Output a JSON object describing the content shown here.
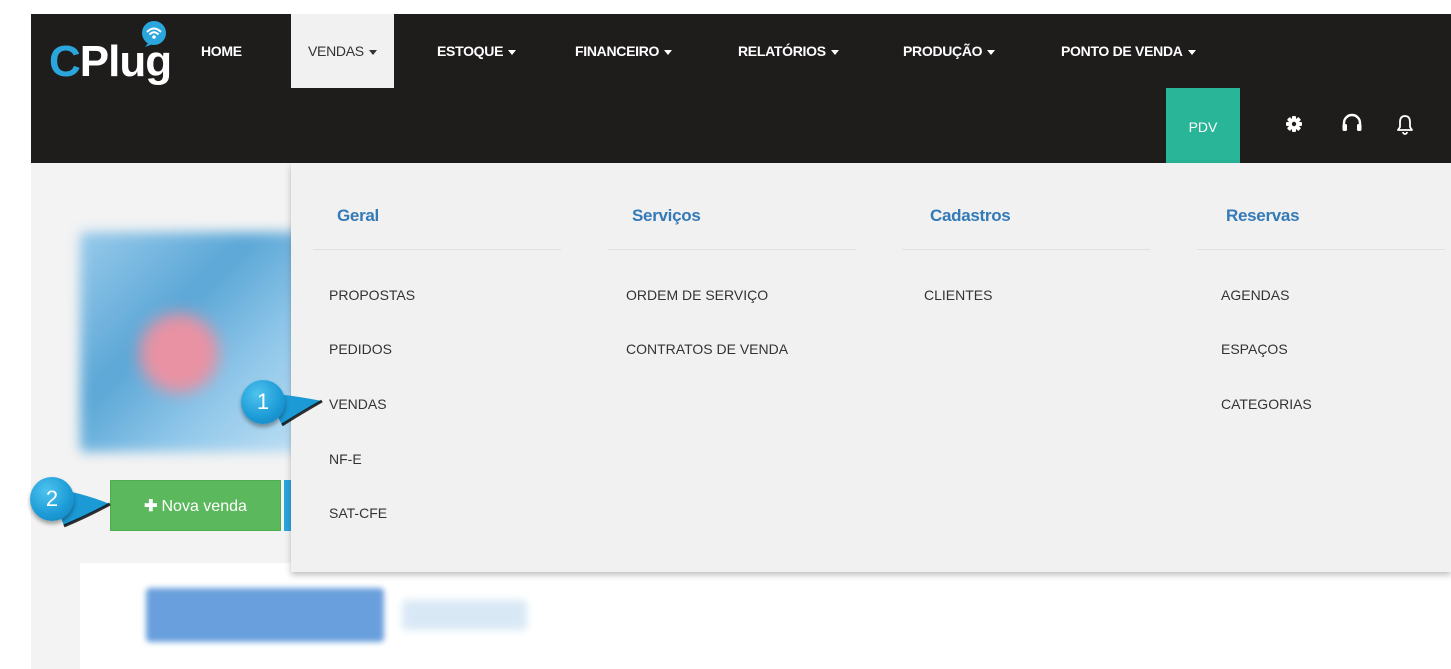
{
  "brand": {
    "logo_text_c": "C",
    "logo_text_rest": "Plug"
  },
  "nav": {
    "items": [
      {
        "label": "HOME"
      },
      {
        "label": "VENDAS"
      },
      {
        "label": "ESTOQUE"
      },
      {
        "label": "FINANCEIRO"
      },
      {
        "label": "RELATÓRIOS"
      },
      {
        "label": "PRODUÇÃO"
      },
      {
        "label": "PONTO DE VENDA"
      }
    ],
    "pdv_label": "PDV",
    "icons": [
      "gear-icon",
      "headset-icon",
      "bell-icon"
    ]
  },
  "dropdown": {
    "columns": [
      {
        "heading": "Geral",
        "links": [
          "PROPOSTAS",
          "PEDIDOS",
          "VENDAS",
          "NF-E",
          "SAT-CFE"
        ]
      },
      {
        "heading": "Serviços",
        "links": [
          "ORDEM DE SERVIÇO",
          "CONTRATOS DE VENDA"
        ]
      },
      {
        "heading": "Cadastros",
        "links": [
          "CLIENTES"
        ]
      },
      {
        "heading": "Reservas",
        "links": [
          "AGENDAS",
          "ESPAÇOS",
          "CATEGORIAS"
        ]
      }
    ]
  },
  "page": {
    "new_sale_label": "Nova venda"
  },
  "callouts": [
    {
      "number": "1"
    },
    {
      "number": "2"
    }
  ],
  "colors": {
    "navbar": "#1f1c1c",
    "pdv": "#28b598",
    "accent": "#337ab7",
    "new_sale": "#5cb85c",
    "callout": "#1b9ad6"
  }
}
